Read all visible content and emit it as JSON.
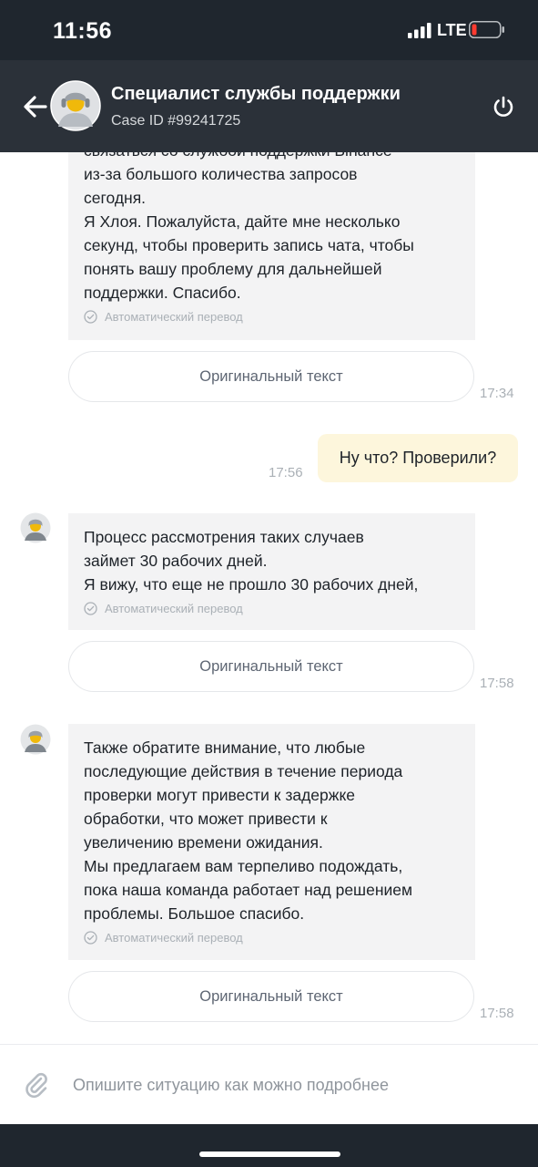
{
  "status_bar": {
    "time": "11:56",
    "network": "LTE",
    "icons": [
      "signal-bars-icon",
      "battery-low-icon"
    ],
    "battery_color": "#ff3b30"
  },
  "header": {
    "back_icon": "arrow-left-icon",
    "title": "Специалист службы поддержки",
    "subtitle": "Case ID #99241725",
    "end_icon": "power-icon",
    "background": "#2b3139"
  },
  "messages": [
    {
      "sender": "agent",
      "text": "связаться со службой поддержки Binance\nиз-за большого количества запросов\nсегодня.\nЯ Хлоя. Пожалуйста, дайте мне несколько\nсекунд, чтобы проверить запись чата, чтобы\nпонять вашу проблему для дальнейшей\nподдержки. Спасибо.",
      "translation_note": "Автоматический перевод",
      "original_button": "Оригинальный текст",
      "time": "17:34"
    },
    {
      "sender": "user",
      "text": "Ну что? Проверили?",
      "time": "17:56"
    },
    {
      "sender": "agent",
      "text": "Процесс рассмотрения таких случаев\nзаймет 30 рабочих дней.\nЯ вижу, что еще не прошло 30 рабочих дней,",
      "translation_note": "Автоматический перевод",
      "original_button": "Оригинальный текст",
      "time": "17:58"
    },
    {
      "sender": "agent",
      "text": "Также обратите внимание, что любые\nпоследующие действия в течение периода\nпроверки могут привести к задержке\nобработки, что может привести к\nувеличению времени ожидания.\nМы предлагаем вам терпеливо подождать,\nпока наша команда работает над решением\nпроблемы. Большое спасибо.",
      "translation_note": "Автоматический перевод",
      "original_button": "Оригинальный текст",
      "time": "17:58"
    }
  ],
  "composer": {
    "attach_icon": "paperclip-icon",
    "placeholder": "Опишите ситуацию как можно подробнее",
    "value": ""
  },
  "colors": {
    "agent_bubble": "#f3f3f4",
    "user_bubble": "#fdf6dc",
    "avatar_accent": "#f0b90b"
  }
}
